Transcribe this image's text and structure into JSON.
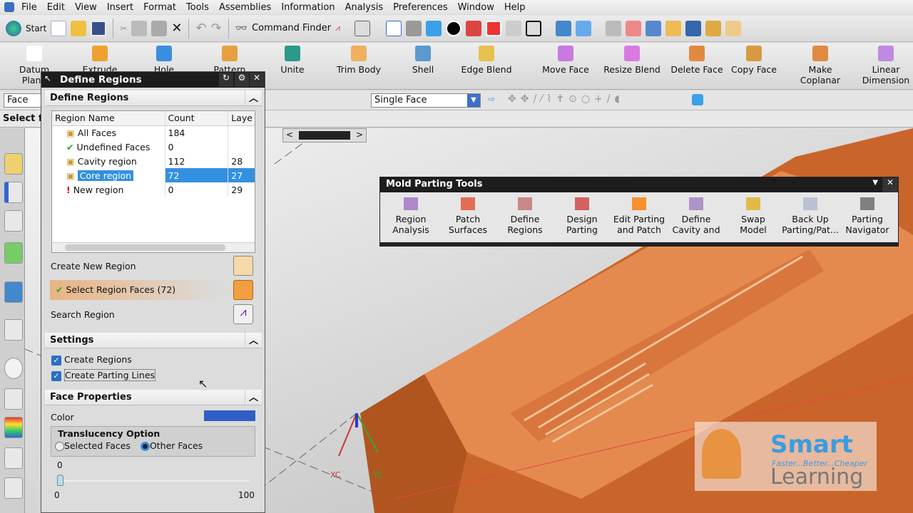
{
  "menu": [
    "File",
    "Edit",
    "View",
    "Insert",
    "Format",
    "Tools",
    "Assemblies",
    "Information",
    "Analysis",
    "Preferences",
    "Window",
    "Help"
  ],
  "toolbar": {
    "start": "Start",
    "command_finder": "Command Finder"
  },
  "ribbon": [
    "Datum Plane",
    "Extrude",
    "Hole",
    "Pattern",
    "Unite",
    "Trim Body",
    "Shell",
    "Edge Blend",
    "Move Face",
    "Resize Blend",
    "Delete Face",
    "Copy Face",
    "Make Coplanar",
    "Linear Dimension"
  ],
  "selection": {
    "filter": "Face",
    "rule": "Single Face"
  },
  "status": "Select fa",
  "dialog": {
    "title": "Define Regions",
    "section": "Define Regions",
    "columns": [
      "Region Name",
      "Count",
      "Laye"
    ],
    "rows": [
      {
        "name": "All Faces",
        "count": "184",
        "layer": ""
      },
      {
        "name": "Undefined Faces",
        "count": "0",
        "layer": ""
      },
      {
        "name": "Cavity region",
        "count": "112",
        "layer": "28"
      },
      {
        "name": "Core region",
        "count": "72",
        "layer": "27"
      },
      {
        "name": "New region",
        "count": "0",
        "layer": "29"
      }
    ],
    "create_new_region": "Create New Region",
    "select_region_faces": "Select Region Faces (72)",
    "search_region": "Search Region",
    "settings": "Settings",
    "create_regions": "Create Regions",
    "create_parting_lines": "Create Parting Lines",
    "face_properties": "Face Properties",
    "color_label": "Color",
    "color": "#2f5fc4",
    "translucency": "Translucency Option",
    "selected_faces": "Selected Faces",
    "other_faces": "Other Faces",
    "slider_value": "0",
    "slider_min": "0",
    "slider_max": "100"
  },
  "mold": {
    "title": "Mold Parting Tools",
    "tools": [
      [
        "Region",
        "Analysis"
      ],
      [
        "Patch",
        "Surfaces"
      ],
      [
        "Define",
        "Regions"
      ],
      [
        "Design",
        "Parting"
      ],
      [
        "Edit Parting",
        "and Patch"
      ],
      [
        "Define",
        "Cavity and"
      ],
      [
        "Swap",
        "Model"
      ],
      [
        "Back Up",
        "Parting/Pat..."
      ],
      [
        "Parting",
        "Navigator"
      ]
    ]
  },
  "axes": {
    "x": "XC",
    "y": "YC"
  },
  "watermark": {
    "brand": "Smart",
    "tagline": "Faster...Better...Cheaper",
    "sub": "Learning"
  }
}
